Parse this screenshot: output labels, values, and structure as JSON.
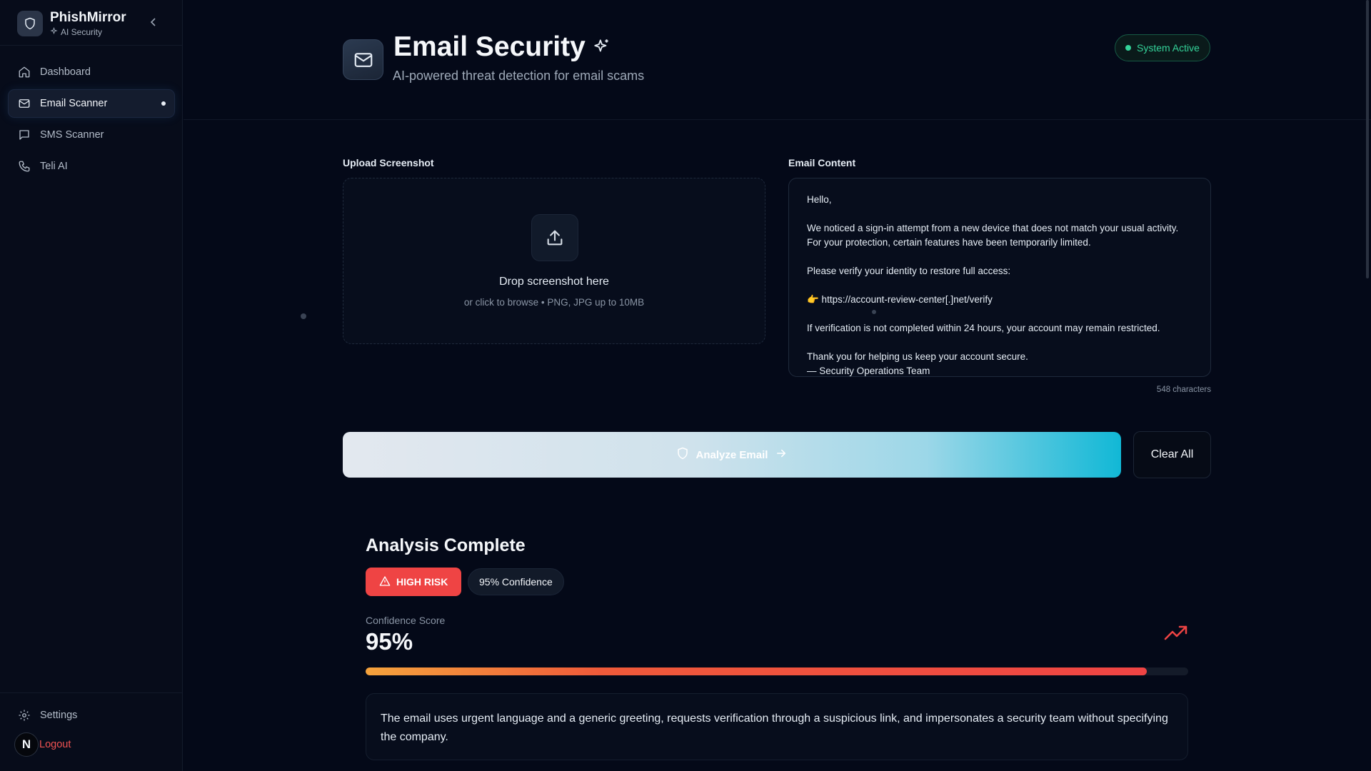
{
  "brand": {
    "name": "PhishMirror",
    "subtitle": "AI Security"
  },
  "sidebar": {
    "items": [
      {
        "label": "Dashboard",
        "icon": "home-icon",
        "active": false
      },
      {
        "label": "Email Scanner",
        "icon": "mail-icon",
        "active": true
      },
      {
        "label": "SMS Scanner",
        "icon": "message-icon",
        "active": false
      },
      {
        "label": "Teli AI",
        "icon": "phone-icon",
        "active": false
      }
    ],
    "settings_label": "Settings",
    "logout_label": "Logout",
    "avatar_initial": "N"
  },
  "header": {
    "title": "Email Security",
    "subtitle": "AI-powered threat detection for email scams",
    "status": "System Active"
  },
  "upload": {
    "label": "Upload Screenshot",
    "drop_title": "Drop screenshot here",
    "drop_sub": "or click to browse • PNG, JPG up to 10MB"
  },
  "email": {
    "label": "Email Content",
    "lines": {
      "l1": "Hello,",
      "l2": "We noticed a sign-in attempt from a new device that does not match your usual activity. For your protection, certain features have been temporarily limited.",
      "l3": "Please verify your identity to restore full access:",
      "l4": "👉 https://account-review-center[.]net/verify",
      "l5": "If verification is not completed within 24 hours, your account may remain restricted.",
      "l6": "Thank you for helping us keep your account secure.",
      "l7": "— Security Operations Team"
    },
    "char_count": "548 characters"
  },
  "actions": {
    "analyze": "Analyze Email",
    "clear": "Clear All"
  },
  "result": {
    "title": "Analysis Complete",
    "risk": "HIGH RISK",
    "confidence_badge": "95% Confidence",
    "score_label": "Confidence Score",
    "score_value": "95%",
    "score_fraction": 0.95,
    "summary": "The email uses urgent language and a generic greeting, requests verification through a suspicious link, and impersonates a security team without specifying the company."
  },
  "colors": {
    "risk": "#ef4444",
    "status": "#34d399",
    "accent": "#11b8d6"
  }
}
